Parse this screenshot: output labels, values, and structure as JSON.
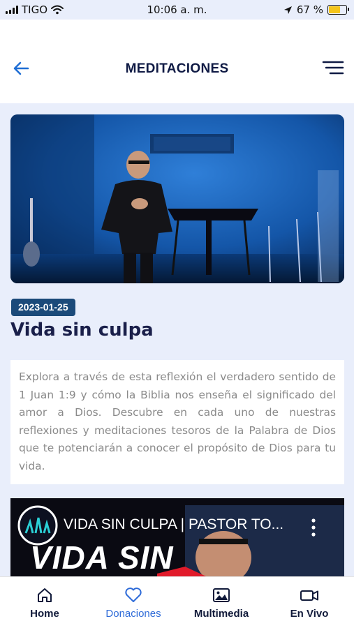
{
  "status_bar": {
    "carrier": "TIGO",
    "time": "10:06 a. m.",
    "battery_percent": "67 %",
    "battery_level": 0.67
  },
  "header": {
    "title": "MEDITACIONES",
    "back_icon": "arrow-left-icon",
    "menu_icon": "menu-lines-icon"
  },
  "meditation": {
    "date": "2023-01-25",
    "title": "Vida sin culpa",
    "description": "Explora a través de esta reflexión el verdadero sentido de 1 Juan 1:9 y cómo la Biblia nos enseña el significado del amor a Dios. Descubre en cada uno de nuestras reflexiones y meditaciones tesoros de la Palabra de Dios que te potenciarán a conocer el propósito de Dios para tu vida."
  },
  "video": {
    "title": "VIDA SIN CULPA | PASTOR TO...",
    "thumbnail_text": "VIDA SIN"
  },
  "tabbar": {
    "items": [
      {
        "label": "Home",
        "icon": "home-icon",
        "active": false
      },
      {
        "label": "Donaciones",
        "icon": "heart-icon",
        "active": true
      },
      {
        "label": "Multimedia",
        "icon": "image-icon",
        "active": false
      },
      {
        "label": "En Vivo",
        "icon": "video-camera-icon",
        "active": false
      }
    ]
  },
  "colors": {
    "accent": "#2e6bd8",
    "title": "#0f1a44",
    "badge": "#1b4a7a",
    "background": "#e9eefb"
  }
}
